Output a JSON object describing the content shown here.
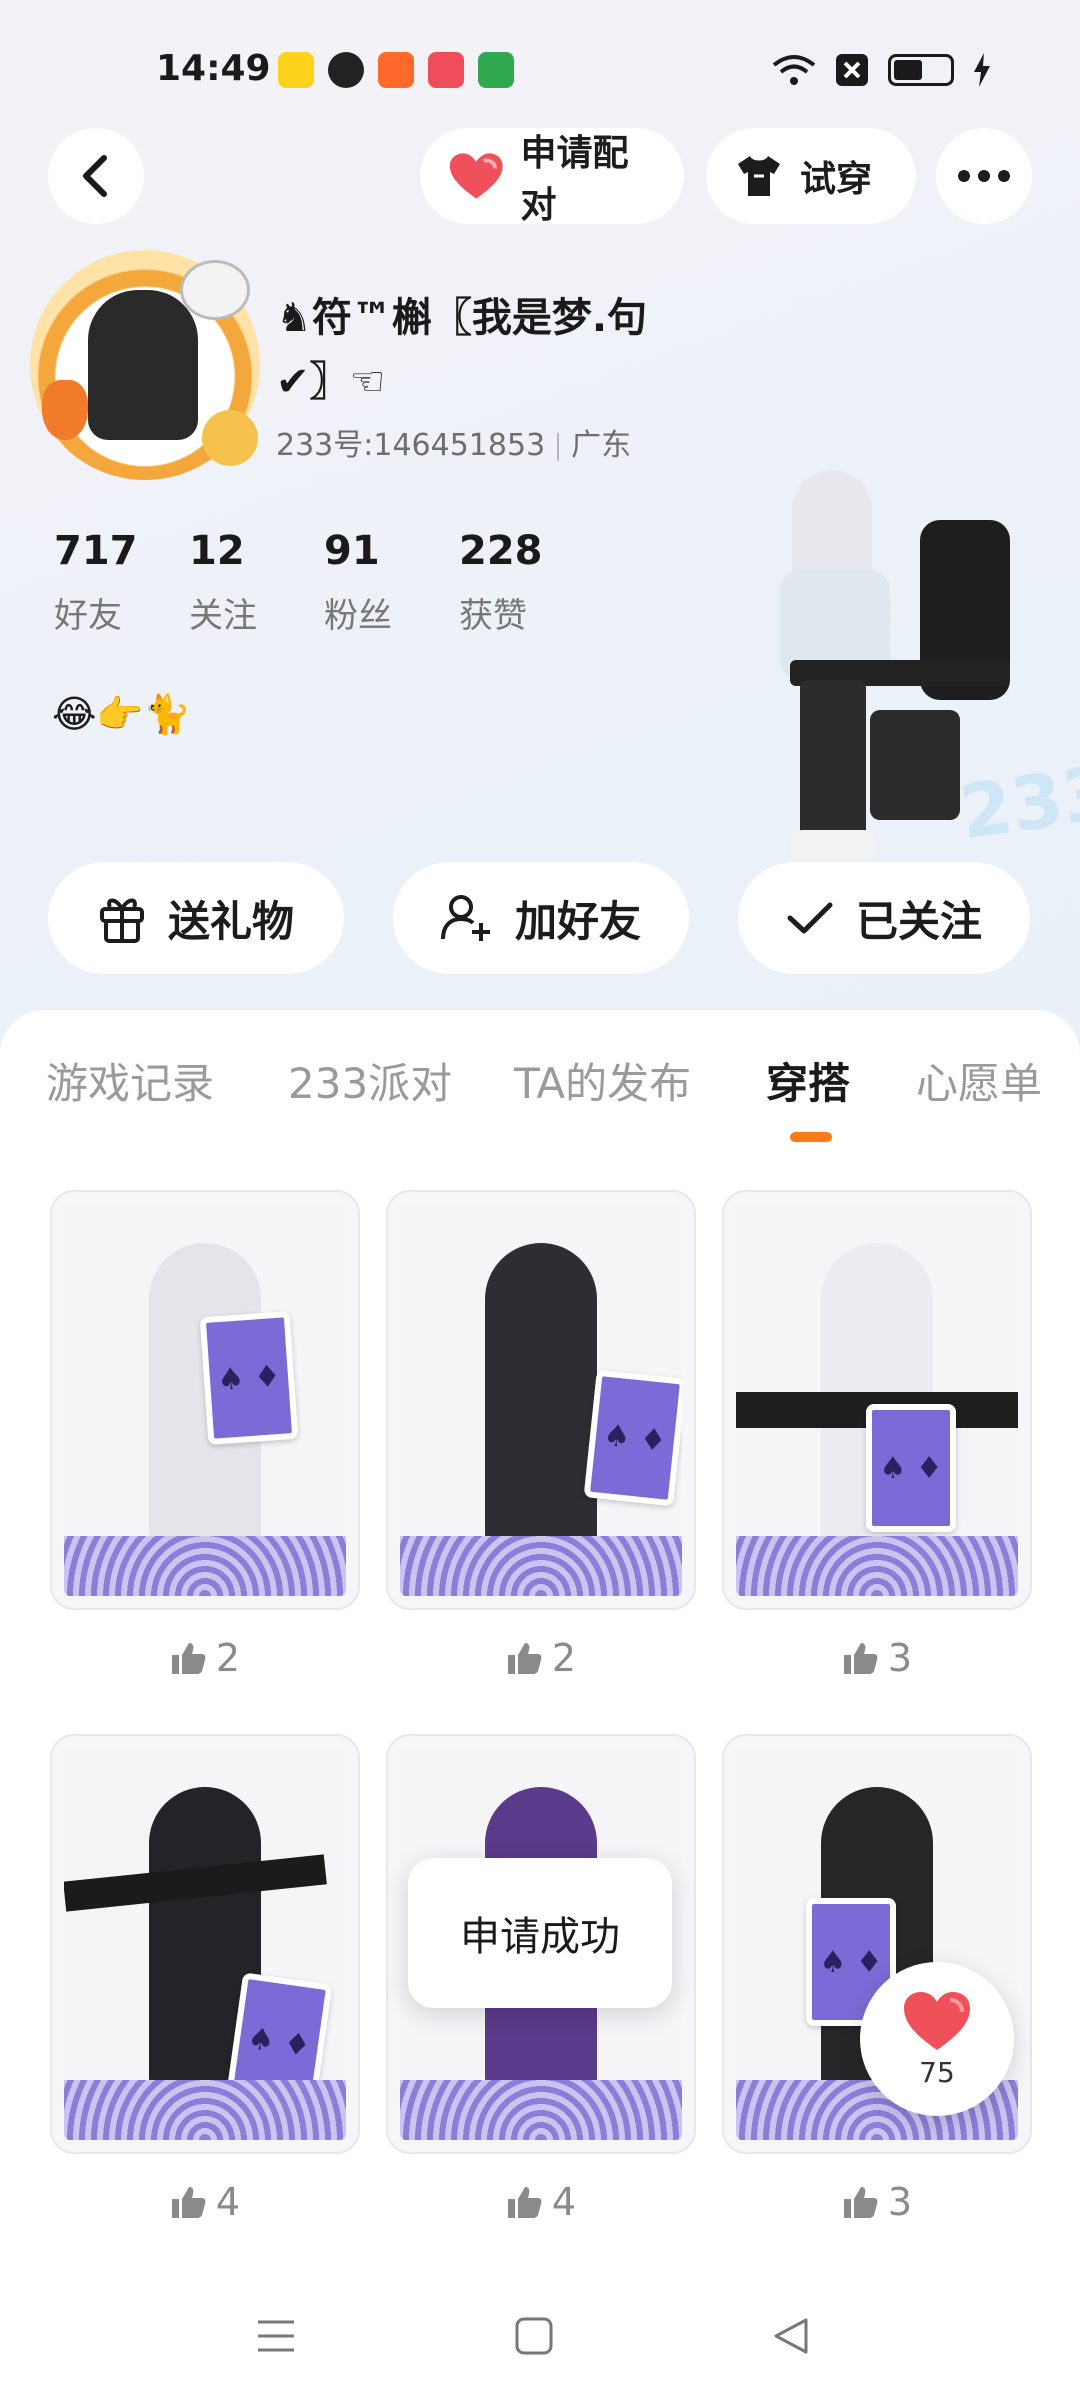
{
  "status_bar": {
    "time": "14:49"
  },
  "header": {
    "pair_label": "申请配对",
    "try_on_label": "试穿"
  },
  "profile": {
    "nickname": "♞符™槲〖我是梦.句✔〗☜",
    "uid": "233号:146451853",
    "region": "广东",
    "stats": [
      {
        "value": "717",
        "label": "好友"
      },
      {
        "value": "12",
        "label": "关注"
      },
      {
        "value": "91",
        "label": "粉丝"
      },
      {
        "value": "228",
        "label": "获赞"
      }
    ],
    "bio": "😂👉🐈"
  },
  "actions": {
    "gift_label": "送礼物",
    "add_friend_label": "加好友",
    "followed_label": "已关注"
  },
  "tabs": [
    {
      "label": "游戏记录"
    },
    {
      "label": "233派对"
    },
    {
      "label": "TA的发布"
    },
    {
      "label": "穿搭"
    },
    {
      "label": "心愿单"
    }
  ],
  "active_tab": "穿搭",
  "outfits": [
    {
      "likes": "2"
    },
    {
      "likes": "2"
    },
    {
      "likes": "3"
    },
    {
      "likes": "4"
    },
    {
      "likes": "4"
    },
    {
      "likes": "3"
    }
  ],
  "toast": "申请成功",
  "like_button": {
    "count": "75"
  },
  "colors": {
    "accent": "#ff7a1a",
    "heart": "#f0505a"
  },
  "icons": [
    "back-icon",
    "heart-icon",
    "shirt-icon",
    "more-icon",
    "gift-icon",
    "add-user-icon",
    "check-icon",
    "thumb-up-icon"
  ]
}
